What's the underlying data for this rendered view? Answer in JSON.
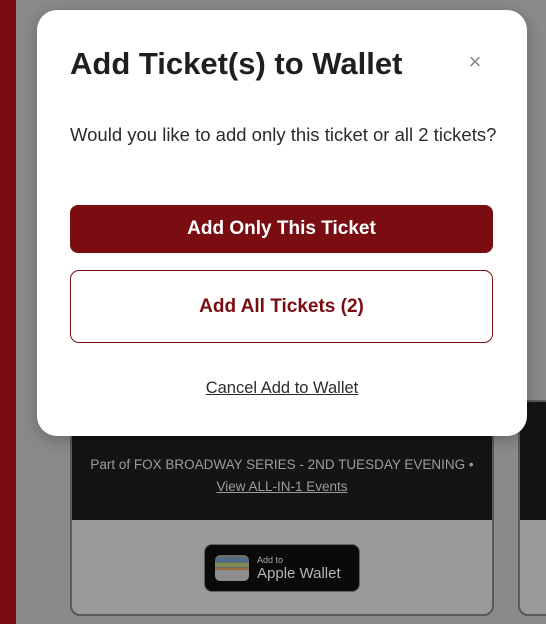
{
  "modal": {
    "title": "Add Ticket(s) to Wallet",
    "close_glyph": "×",
    "message": "Would you like to add only this ticket or all 2 tickets?",
    "add_only_label": "Add Only This Ticket",
    "add_all_label": "Add All Tickets (2)",
    "cancel_label": "Cancel Add to Wallet"
  },
  "ticket": {
    "series_prefix": "Part of FOX BROADWAY SERIES - 2ND TUESDAY EVENING • ",
    "events_link": "View ALL-IN-1 Events",
    "wallet_small": "Add to",
    "wallet_big": "Apple Wallet"
  },
  "colors": {
    "brand": "#7a0d12",
    "overlay": "#8a8a8a"
  },
  "icons": {
    "close": "close-icon",
    "wallet": "apple-wallet-icon"
  }
}
